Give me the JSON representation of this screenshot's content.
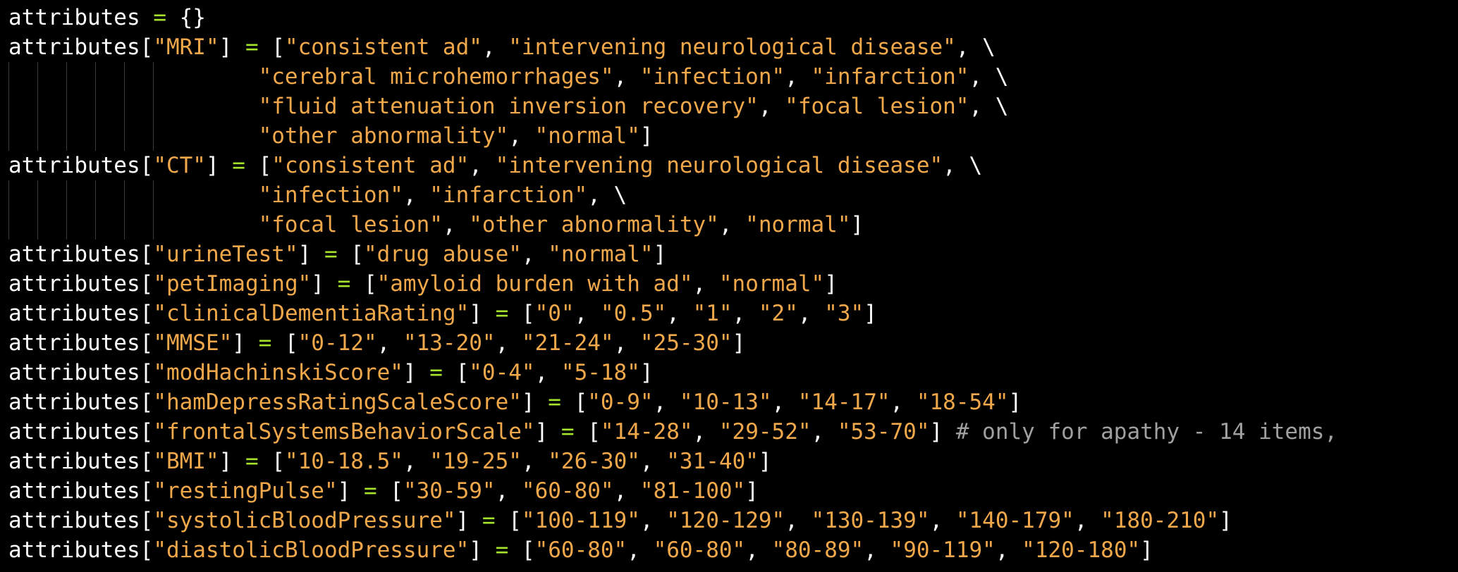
{
  "editor": {
    "colors": {
      "background": "#000000",
      "identifier": "#ffffff",
      "operator": "#a6e22e",
      "string": "#f0a84a",
      "comment": "#a0a0a0",
      "indent_guide": "#3a3a3a"
    },
    "lines": [
      [
        {
          "t": "id",
          "v": "attributes "
        },
        {
          "t": "op",
          "v": "="
        },
        {
          "t": "punc",
          "v": " {}"
        }
      ],
      [
        {
          "t": "id",
          "v": "attributes["
        },
        {
          "t": "str",
          "v": "\"MRI\""
        },
        {
          "t": "punc",
          "v": "] "
        },
        {
          "t": "op",
          "v": "="
        },
        {
          "t": "punc",
          "v": " ["
        },
        {
          "t": "str",
          "v": "\"consistent ad\""
        },
        {
          "t": "punc",
          "v": ", "
        },
        {
          "t": "str",
          "v": "\"intervening neurological disease\""
        },
        {
          "t": "punc",
          "v": ", \\"
        }
      ],
      [
        {
          "t": "ws",
          "v": "                   "
        },
        {
          "t": "str",
          "v": "\"cerebral microhemorrhages\""
        },
        {
          "t": "punc",
          "v": ", "
        },
        {
          "t": "str",
          "v": "\"infection\""
        },
        {
          "t": "punc",
          "v": ", "
        },
        {
          "t": "str",
          "v": "\"infarction\""
        },
        {
          "t": "punc",
          "v": ", \\"
        }
      ],
      [
        {
          "t": "ws",
          "v": "                   "
        },
        {
          "t": "str",
          "v": "\"fluid attenuation inversion recovery\""
        },
        {
          "t": "punc",
          "v": ", "
        },
        {
          "t": "str",
          "v": "\"focal lesion\""
        },
        {
          "t": "punc",
          "v": ", \\"
        }
      ],
      [
        {
          "t": "ws",
          "v": "                   "
        },
        {
          "t": "str",
          "v": "\"other abnormality\""
        },
        {
          "t": "punc",
          "v": ", "
        },
        {
          "t": "str",
          "v": "\"normal\""
        },
        {
          "t": "punc",
          "v": "]"
        }
      ],
      [
        {
          "t": "id",
          "v": "attributes["
        },
        {
          "t": "str",
          "v": "\"CT\""
        },
        {
          "t": "punc",
          "v": "] "
        },
        {
          "t": "op",
          "v": "="
        },
        {
          "t": "punc",
          "v": " ["
        },
        {
          "t": "str",
          "v": "\"consistent ad\""
        },
        {
          "t": "punc",
          "v": ", "
        },
        {
          "t": "str",
          "v": "\"intervening neurological disease\""
        },
        {
          "t": "punc",
          "v": ", \\"
        }
      ],
      [
        {
          "t": "ws",
          "v": "                   "
        },
        {
          "t": "str",
          "v": "\"infection\""
        },
        {
          "t": "punc",
          "v": ", "
        },
        {
          "t": "str",
          "v": "\"infarction\""
        },
        {
          "t": "punc",
          "v": ", \\"
        }
      ],
      [
        {
          "t": "ws",
          "v": "                   "
        },
        {
          "t": "str",
          "v": "\"focal lesion\""
        },
        {
          "t": "punc",
          "v": ", "
        },
        {
          "t": "str",
          "v": "\"other abnormality\""
        },
        {
          "t": "punc",
          "v": ", "
        },
        {
          "t": "str",
          "v": "\"normal\""
        },
        {
          "t": "punc",
          "v": "]"
        }
      ],
      [
        {
          "t": "id",
          "v": "attributes["
        },
        {
          "t": "str",
          "v": "\"urineTest\""
        },
        {
          "t": "punc",
          "v": "] "
        },
        {
          "t": "op",
          "v": "="
        },
        {
          "t": "punc",
          "v": " ["
        },
        {
          "t": "str",
          "v": "\"drug abuse\""
        },
        {
          "t": "punc",
          "v": ", "
        },
        {
          "t": "str",
          "v": "\"normal\""
        },
        {
          "t": "punc",
          "v": "]"
        }
      ],
      [
        {
          "t": "id",
          "v": "attributes["
        },
        {
          "t": "str",
          "v": "\"petImaging\""
        },
        {
          "t": "punc",
          "v": "] "
        },
        {
          "t": "op",
          "v": "="
        },
        {
          "t": "punc",
          "v": " ["
        },
        {
          "t": "str",
          "v": "\"amyloid burden with ad\""
        },
        {
          "t": "punc",
          "v": ", "
        },
        {
          "t": "str",
          "v": "\"normal\""
        },
        {
          "t": "punc",
          "v": "]"
        }
      ],
      [
        {
          "t": "id",
          "v": "attributes["
        },
        {
          "t": "str",
          "v": "\"clinicalDementiaRating\""
        },
        {
          "t": "punc",
          "v": "] "
        },
        {
          "t": "op",
          "v": "="
        },
        {
          "t": "punc",
          "v": " ["
        },
        {
          "t": "str",
          "v": "\"0\""
        },
        {
          "t": "punc",
          "v": ", "
        },
        {
          "t": "str",
          "v": "\"0.5\""
        },
        {
          "t": "punc",
          "v": ", "
        },
        {
          "t": "str",
          "v": "\"1\""
        },
        {
          "t": "punc",
          "v": ", "
        },
        {
          "t": "str",
          "v": "\"2\""
        },
        {
          "t": "punc",
          "v": ", "
        },
        {
          "t": "str",
          "v": "\"3\""
        },
        {
          "t": "punc",
          "v": "]"
        }
      ],
      [
        {
          "t": "id",
          "v": "attributes["
        },
        {
          "t": "str",
          "v": "\"MMSE\""
        },
        {
          "t": "punc",
          "v": "] "
        },
        {
          "t": "op",
          "v": "="
        },
        {
          "t": "punc",
          "v": " ["
        },
        {
          "t": "str",
          "v": "\"0-12\""
        },
        {
          "t": "punc",
          "v": ", "
        },
        {
          "t": "str",
          "v": "\"13-20\""
        },
        {
          "t": "punc",
          "v": ", "
        },
        {
          "t": "str",
          "v": "\"21-24\""
        },
        {
          "t": "punc",
          "v": ", "
        },
        {
          "t": "str",
          "v": "\"25-30\""
        },
        {
          "t": "punc",
          "v": "]"
        }
      ],
      [
        {
          "t": "id",
          "v": "attributes["
        },
        {
          "t": "str",
          "v": "\"modHachinskiScore\""
        },
        {
          "t": "punc",
          "v": "] "
        },
        {
          "t": "op",
          "v": "="
        },
        {
          "t": "punc",
          "v": " ["
        },
        {
          "t": "str",
          "v": "\"0-4\""
        },
        {
          "t": "punc",
          "v": ", "
        },
        {
          "t": "str",
          "v": "\"5-18\""
        },
        {
          "t": "punc",
          "v": "]"
        }
      ],
      [
        {
          "t": "id",
          "v": "attributes["
        },
        {
          "t": "str",
          "v": "\"hamDepressRatingScaleScore\""
        },
        {
          "t": "punc",
          "v": "] "
        },
        {
          "t": "op",
          "v": "="
        },
        {
          "t": "punc",
          "v": " ["
        },
        {
          "t": "str",
          "v": "\"0-9\""
        },
        {
          "t": "punc",
          "v": ", "
        },
        {
          "t": "str",
          "v": "\"10-13\""
        },
        {
          "t": "punc",
          "v": ", "
        },
        {
          "t": "str",
          "v": "\"14-17\""
        },
        {
          "t": "punc",
          "v": ", "
        },
        {
          "t": "str",
          "v": "\"18-54\""
        },
        {
          "t": "punc",
          "v": "]"
        }
      ],
      [
        {
          "t": "id",
          "v": "attributes["
        },
        {
          "t": "str",
          "v": "\"frontalSystemsBehaviorScale\""
        },
        {
          "t": "punc",
          "v": "] "
        },
        {
          "t": "op",
          "v": "="
        },
        {
          "t": "punc",
          "v": " ["
        },
        {
          "t": "str",
          "v": "\"14-28\""
        },
        {
          "t": "punc",
          "v": ", "
        },
        {
          "t": "str",
          "v": "\"29-52\""
        },
        {
          "t": "punc",
          "v": ", "
        },
        {
          "t": "str",
          "v": "\"53-70\""
        },
        {
          "t": "punc",
          "v": "] "
        },
        {
          "t": "comment",
          "v": "# only for apathy - 14 items,"
        }
      ],
      [
        {
          "t": "id",
          "v": "attributes["
        },
        {
          "t": "str",
          "v": "\"BMI\""
        },
        {
          "t": "punc",
          "v": "] "
        },
        {
          "t": "op",
          "v": "="
        },
        {
          "t": "punc",
          "v": " ["
        },
        {
          "t": "str",
          "v": "\"10-18.5\""
        },
        {
          "t": "punc",
          "v": ", "
        },
        {
          "t": "str",
          "v": "\"19-25\""
        },
        {
          "t": "punc",
          "v": ", "
        },
        {
          "t": "str",
          "v": "\"26-30\""
        },
        {
          "t": "punc",
          "v": ", "
        },
        {
          "t": "str",
          "v": "\"31-40\""
        },
        {
          "t": "punc",
          "v": "]"
        }
      ],
      [
        {
          "t": "id",
          "v": "attributes["
        },
        {
          "t": "str",
          "v": "\"restingPulse\""
        },
        {
          "t": "punc",
          "v": "] "
        },
        {
          "t": "op",
          "v": "="
        },
        {
          "t": "punc",
          "v": " ["
        },
        {
          "t": "str",
          "v": "\"30-59\""
        },
        {
          "t": "punc",
          "v": ", "
        },
        {
          "t": "str",
          "v": "\"60-80\""
        },
        {
          "t": "punc",
          "v": ", "
        },
        {
          "t": "str",
          "v": "\"81-100\""
        },
        {
          "t": "punc",
          "v": "]"
        }
      ],
      [
        {
          "t": "id",
          "v": "attributes["
        },
        {
          "t": "str",
          "v": "\"systolicBloodPressure\""
        },
        {
          "t": "punc",
          "v": "] "
        },
        {
          "t": "op",
          "v": "="
        },
        {
          "t": "punc",
          "v": " ["
        },
        {
          "t": "str",
          "v": "\"100-119\""
        },
        {
          "t": "punc",
          "v": ", "
        },
        {
          "t": "str",
          "v": "\"120-129\""
        },
        {
          "t": "punc",
          "v": ", "
        },
        {
          "t": "str",
          "v": "\"130-139\""
        },
        {
          "t": "punc",
          "v": ", "
        },
        {
          "t": "str",
          "v": "\"140-179\""
        },
        {
          "t": "punc",
          "v": ", "
        },
        {
          "t": "str",
          "v": "\"180-210\""
        },
        {
          "t": "punc",
          "v": "]"
        }
      ],
      [
        {
          "t": "id",
          "v": "attributes["
        },
        {
          "t": "str",
          "v": "\"diastolicBloodPressure\""
        },
        {
          "t": "punc",
          "v": "] "
        },
        {
          "t": "op",
          "v": "="
        },
        {
          "t": "punc",
          "v": " ["
        },
        {
          "t": "str",
          "v": "\"60-80\""
        },
        {
          "t": "punc",
          "v": ", "
        },
        {
          "t": "str",
          "v": "\"60-80\""
        },
        {
          "t": "punc",
          "v": ", "
        },
        {
          "t": "str",
          "v": "\"80-89\""
        },
        {
          "t": "punc",
          "v": ", "
        },
        {
          "t": "str",
          "v": "\"90-119\""
        },
        {
          "t": "punc",
          "v": ", "
        },
        {
          "t": "str",
          "v": "\"120-180\""
        },
        {
          "t": "punc",
          "v": "]"
        }
      ]
    ]
  }
}
